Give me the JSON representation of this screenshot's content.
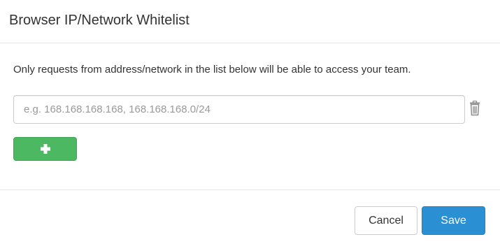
{
  "modal": {
    "title": "Browser IP/Network Whitelist",
    "description": "Only requests from address/network in the list below will be able to access your team.",
    "input": {
      "value": "",
      "placeholder": "e.g. 168.168.168.168, 168.168.168.0/24"
    },
    "icons": {
      "delete": "trash-icon",
      "add": "plus-icon"
    },
    "buttons": {
      "cancel": "Cancel",
      "save": "Save"
    },
    "colors": {
      "add_button": "#4cb962",
      "save_button": "#2a8fd3",
      "trash_icon": "#8c8c8c"
    }
  }
}
